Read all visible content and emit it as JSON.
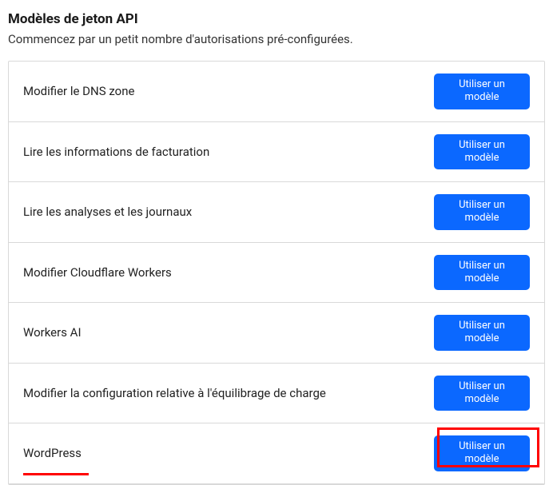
{
  "header": {
    "title": "Modèles de jeton API",
    "subtitle": "Commencez par un petit nombre d'autorisations pré-configurées."
  },
  "button_label": "Utiliser un modèle",
  "templates": [
    {
      "label": "Modifier le DNS zone"
    },
    {
      "label": "Lire les informations de facturation"
    },
    {
      "label": "Lire les analyses et les journaux"
    },
    {
      "label": "Modifier Cloudflare Workers"
    },
    {
      "label": "Workers AI"
    },
    {
      "label": "Modifier la configuration relative à l'équilibrage de charge"
    },
    {
      "label": "WordPress"
    }
  ]
}
